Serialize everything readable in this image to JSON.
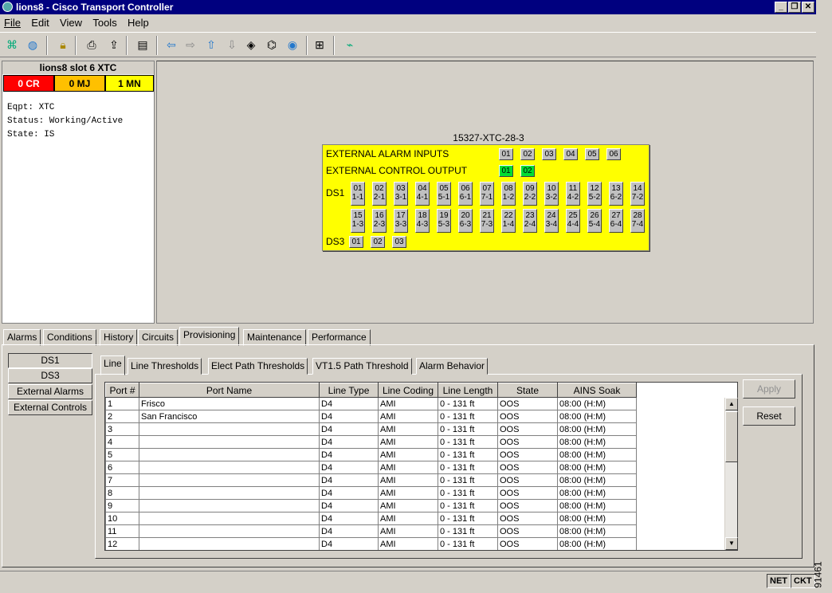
{
  "window": {
    "title": "lions8 - Cisco Transport Controller"
  },
  "menu": [
    "File",
    "Edit",
    "View",
    "Tools",
    "Help"
  ],
  "toolbar": [
    "network-icon",
    "globe-icon",
    "lock-icon",
    "print-icon",
    "export-icon",
    "notes-icon",
    "back-arrow-icon",
    "forward-arrow-icon",
    "up-arrow-icon",
    "down-arrow-icon",
    "node-view-icon",
    "network-view-icon",
    "card-view-icon",
    "tree-icon",
    "graph-icon"
  ],
  "node": {
    "title": "lions8 slot 6 XTC",
    "alarms": {
      "cr": "0 CR",
      "mj": "0 MJ",
      "mn": "1 MN"
    },
    "info": [
      "Eqpt: XTC",
      "Status: Working/Active",
      "State: IS"
    ],
    "colors": {
      "cr": "#ff0000",
      "mj": "#ffc000",
      "mn": "#ffff00"
    }
  },
  "card": {
    "name": "15327-XTC-28-3",
    "ext_alarm_label": "EXTERNAL ALARM INPUTS",
    "ext_alarm_ports": [
      "01",
      "02",
      "03",
      "04",
      "05",
      "06"
    ],
    "ext_control_label": "EXTERNAL CONTROL OUTPUT",
    "ext_control_ports": [
      "01",
      "02"
    ],
    "ds1_label": "DS1",
    "ds1_ports": [
      [
        "01",
        "1-1"
      ],
      [
        "02",
        "2-1"
      ],
      [
        "03",
        "3-1"
      ],
      [
        "04",
        "4-1"
      ],
      [
        "05",
        "5-1"
      ],
      [
        "06",
        "6-1"
      ],
      [
        "07",
        "7-1"
      ],
      [
        "08",
        "1-2"
      ],
      [
        "09",
        "2-2"
      ],
      [
        "10",
        "3-2"
      ],
      [
        "11",
        "4-2"
      ],
      [
        "12",
        "5-2"
      ],
      [
        "13",
        "6-2"
      ],
      [
        "14",
        "7-2"
      ],
      [
        "15",
        "1-3"
      ],
      [
        "16",
        "2-3"
      ],
      [
        "17",
        "3-3"
      ],
      [
        "18",
        "4-3"
      ],
      [
        "19",
        "5-3"
      ],
      [
        "20",
        "6-3"
      ],
      [
        "21",
        "7-3"
      ],
      [
        "22",
        "1-4"
      ],
      [
        "23",
        "2-4"
      ],
      [
        "24",
        "3-4"
      ],
      [
        "25",
        "4-4"
      ],
      [
        "26",
        "5-4"
      ],
      [
        "27",
        "6-4"
      ],
      [
        "28",
        "7-4"
      ]
    ],
    "ds3_label": "DS3",
    "ds3_ports": [
      "01",
      "02",
      "03"
    ]
  },
  "tabs": [
    "Alarms",
    "Conditions",
    "History",
    "Circuits",
    "Provisioning",
    "Maintenance",
    "Performance"
  ],
  "side_buttons": [
    "DS1",
    "DS3",
    "External Alarms",
    "External Controls"
  ],
  "sub_tabs": [
    "Line",
    "Line Thresholds",
    "Elect Path Thresholds",
    "VT1.5 Path Threshold",
    "Alarm Behavior"
  ],
  "table": {
    "columns": [
      "Port #",
      "Port Name",
      "Line Type",
      "Line Coding",
      "Line Length",
      "State",
      "AINS Soak"
    ],
    "rows": [
      [
        "1",
        "Frisco",
        "D4",
        "AMI",
        "0 - 131 ft",
        "OOS",
        "08:00 (H:M)"
      ],
      [
        "2",
        "San Francisco",
        "D4",
        "AMI",
        "0 - 131 ft",
        "OOS",
        "08:00 (H:M)"
      ],
      [
        "3",
        "",
        "D4",
        "AMI",
        "0 - 131 ft",
        "OOS",
        "08:00 (H:M)"
      ],
      [
        "4",
        "",
        "D4",
        "AMI",
        "0 - 131 ft",
        "OOS",
        "08:00 (H:M)"
      ],
      [
        "5",
        "",
        "D4",
        "AMI",
        "0 - 131 ft",
        "OOS",
        "08:00 (H:M)"
      ],
      [
        "6",
        "",
        "D4",
        "AMI",
        "0 - 131 ft",
        "OOS",
        "08:00 (H:M)"
      ],
      [
        "7",
        "",
        "D4",
        "AMI",
        "0 - 131 ft",
        "OOS",
        "08:00 (H:M)"
      ],
      [
        "8",
        "",
        "D4",
        "AMI",
        "0 - 131 ft",
        "OOS",
        "08:00 (H:M)"
      ],
      [
        "9",
        "",
        "D4",
        "AMI",
        "0 - 131 ft",
        "OOS",
        "08:00 (H:M)"
      ],
      [
        "10",
        "",
        "D4",
        "AMI",
        "0 - 131 ft",
        "OOS",
        "08:00 (H:M)"
      ],
      [
        "11",
        "",
        "D4",
        "AMI",
        "0 - 131 ft",
        "OOS",
        "08:00 (H:M)"
      ],
      [
        "12",
        "",
        "D4",
        "AMI",
        "0 - 131 ft",
        "OOS",
        "08:00 (H:M)"
      ]
    ]
  },
  "buttons": {
    "apply": "Apply",
    "reset": "Reset"
  },
  "status": {
    "net": "NET",
    "ckt": "CKT"
  },
  "figure_id": "91461"
}
